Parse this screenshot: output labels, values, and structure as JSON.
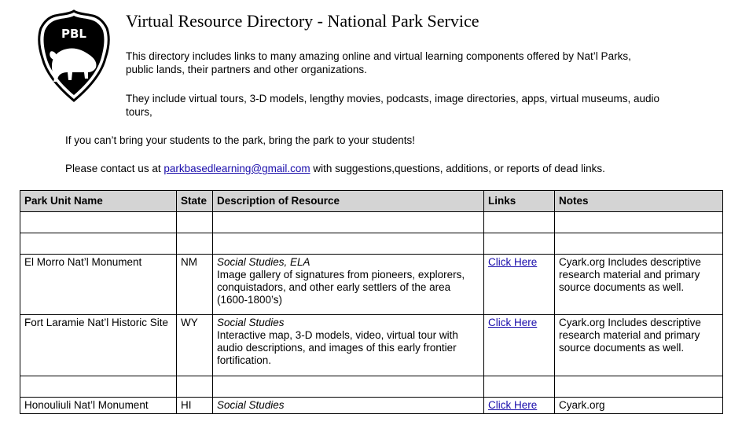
{
  "logo": {
    "text": "PBL"
  },
  "header": {
    "title": "Virtual Resource Directory - National Park Service"
  },
  "intro": {
    "p1": "This directory includes links to many amazing online and virtual learning components offered by Nat’l Parks, public lands, their partners and other organizations.",
    "p2": "They include virtual tours, 3-D models, lengthy movies, podcasts, image directories, apps, virtual museums, audio tours,",
    "p3": "If you can’t bring your students to the park, bring the park to your students!",
    "p4_before": "Please contact us at ",
    "p4_email": "parkbasedlearning@gmail.com",
    "p4_after": " with suggestions,questions, additions, or reports of dead links."
  },
  "table": {
    "headers": {
      "park": "Park Unit Name",
      "state": "State",
      "desc": "Description of Resource",
      "links": "Links",
      "notes": "Notes"
    },
    "rows": [
      {
        "park": "El Morro Nat’l Monument",
        "state": "NM",
        "category": "Social Studies, ELA",
        "desc": "Image gallery of signatures from pioneers, explorers, conquistadors, and other early settlers of the area (1600-1800’s)",
        "link": "Click Here",
        "notes": "Cyark.org Includes descriptive research material and primary source documents as well."
      },
      {
        "park": "Fort Laramie Nat’l Historic Site",
        "state": "WY",
        "category": "Social Studies",
        "desc": "Interactive map, 3-D models, video, virtual tour with audio descriptions, and images of this early frontier fortification.",
        "link": "Click Here",
        "notes": "Cyark.org Includes descriptive research material and primary source documents as well."
      },
      {
        "park": "Honouliuli Nat’l Monument",
        "state": "HI",
        "category": "Social Studies",
        "desc": "",
        "link": "Click Here",
        "notes": "Cyark.org"
      }
    ]
  }
}
